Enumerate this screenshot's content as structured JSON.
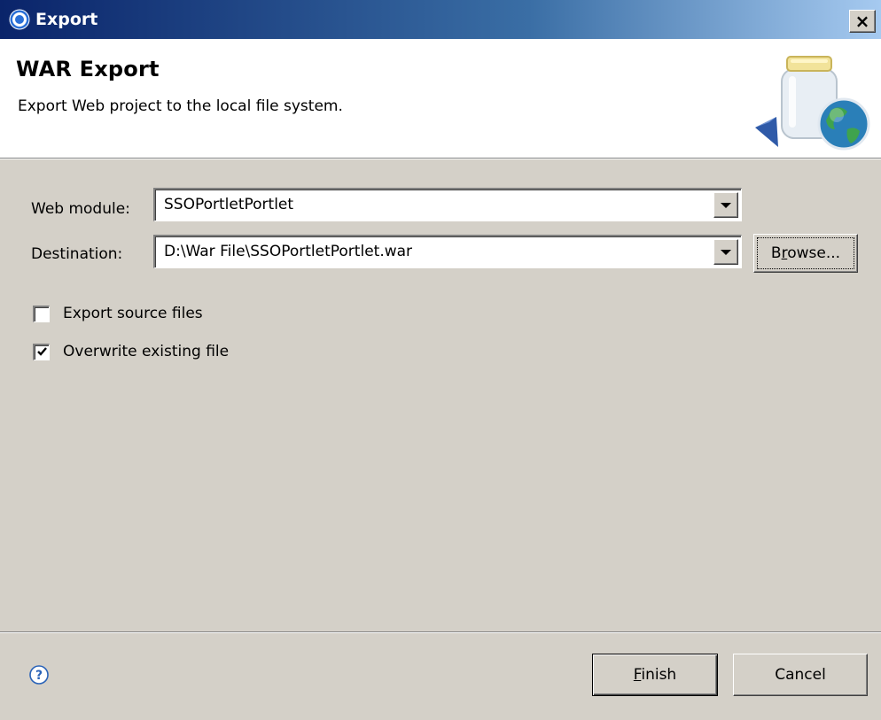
{
  "window": {
    "title": "Export",
    "close_glyph": "×"
  },
  "banner": {
    "title": "WAR Export",
    "description": "Export Web project to the local file system.",
    "icon": "war-export-jar-globe-icon"
  },
  "form": {
    "web_module": {
      "label": "Web module:",
      "value": "SSOPortletPortlet"
    },
    "destination": {
      "label": "Destination:",
      "value": "D:\\War File\\SSOPortletPortlet.war",
      "browse_pre": "B",
      "browse_mnemonic": "r",
      "browse_post": "owse..."
    },
    "options": [
      {
        "label": "Export source files",
        "checked": false
      },
      {
        "label": "Overwrite existing file",
        "checked": true
      }
    ]
  },
  "footer": {
    "help_icon": "help-icon",
    "finish_mnemonic": "F",
    "finish_rest": "inish",
    "cancel_label": "Cancel"
  },
  "colors": {
    "titlebar_start": "#0a246a",
    "titlebar_end": "#a6caf0",
    "dialog_bg": "#d4d0c8",
    "banner_bg": "#ffffff"
  }
}
